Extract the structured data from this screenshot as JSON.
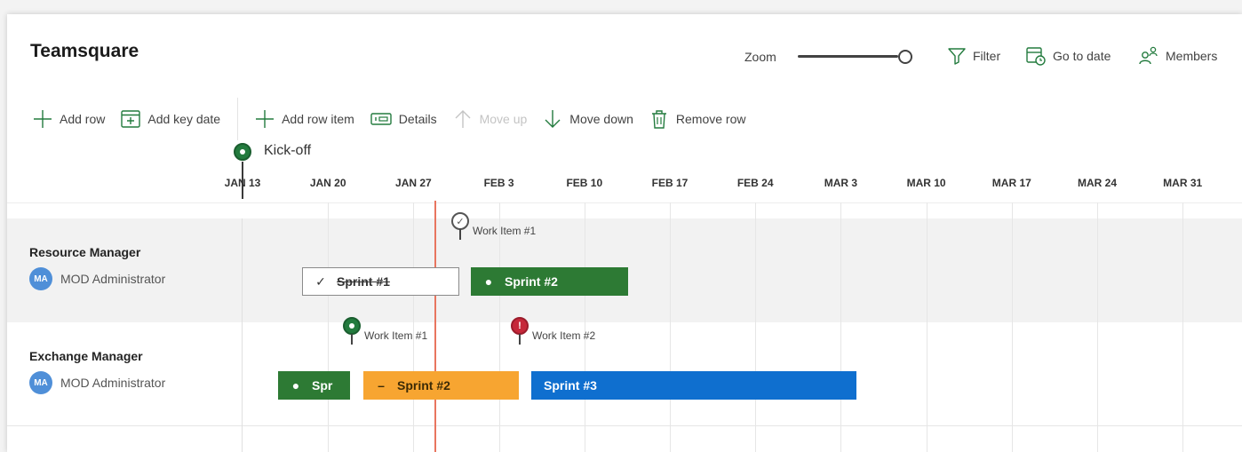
{
  "app": {
    "title": "Teamsquare"
  },
  "header": {
    "zoom_label": "Zoom",
    "zoom_level": 0.95,
    "filter_label": "Filter",
    "go_to_date_label": "Go to date",
    "members_label": "Members"
  },
  "toolbar": {
    "add_row": "Add row",
    "add_key_date": "Add key date",
    "add_row_item": "Add row item",
    "details": "Details",
    "move_up": "Move up",
    "move_down": "Move down",
    "remove_row": "Remove row"
  },
  "key_date": {
    "label": "Kick-off",
    "date": "JAN 13"
  },
  "timeline": {
    "dates": [
      "JAN 13",
      "JAN 20",
      "JAN 27",
      "FEB 3",
      "FEB 10",
      "FEB 17",
      "FEB 24",
      "MAR 3",
      "MAR 10",
      "MAR 17",
      "MAR 24",
      "MAR 31"
    ]
  },
  "rows": [
    {
      "name": "Resource Manager",
      "member": {
        "initials": "MA",
        "name": "MOD Administrator"
      },
      "work_items": [
        {
          "label": "Work Item #1",
          "status": "done",
          "icon": "check-circle-icon"
        }
      ],
      "bars": [
        {
          "label": "Sprint #1",
          "status": "done",
          "mark": "✓"
        },
        {
          "label": "Sprint #2",
          "status": "in-progress",
          "mark": "●"
        }
      ]
    },
    {
      "name": "Exchange Manager",
      "member": {
        "initials": "MA",
        "name": "MOD Administrator"
      },
      "work_items": [
        {
          "label": "Work Item #1",
          "status": "on-track",
          "icon": "dot-pin-icon"
        },
        {
          "label": "Work Item #2",
          "status": "at-risk",
          "mark": "!",
          "icon": "alert-pin-icon"
        }
      ],
      "bars": [
        {
          "label": "Spr",
          "status": "in-progress",
          "mark": "●"
        },
        {
          "label": "Sprint #2",
          "status": "paused",
          "mark": "–"
        },
        {
          "label": "Sprint #3",
          "status": "planned",
          "mark": ""
        }
      ]
    }
  ],
  "colors": {
    "green": "#2d7a34",
    "orange": "#f7a531",
    "blue": "#0f6fcf",
    "red": "#c6283a",
    "today_line": "#e8755f"
  }
}
